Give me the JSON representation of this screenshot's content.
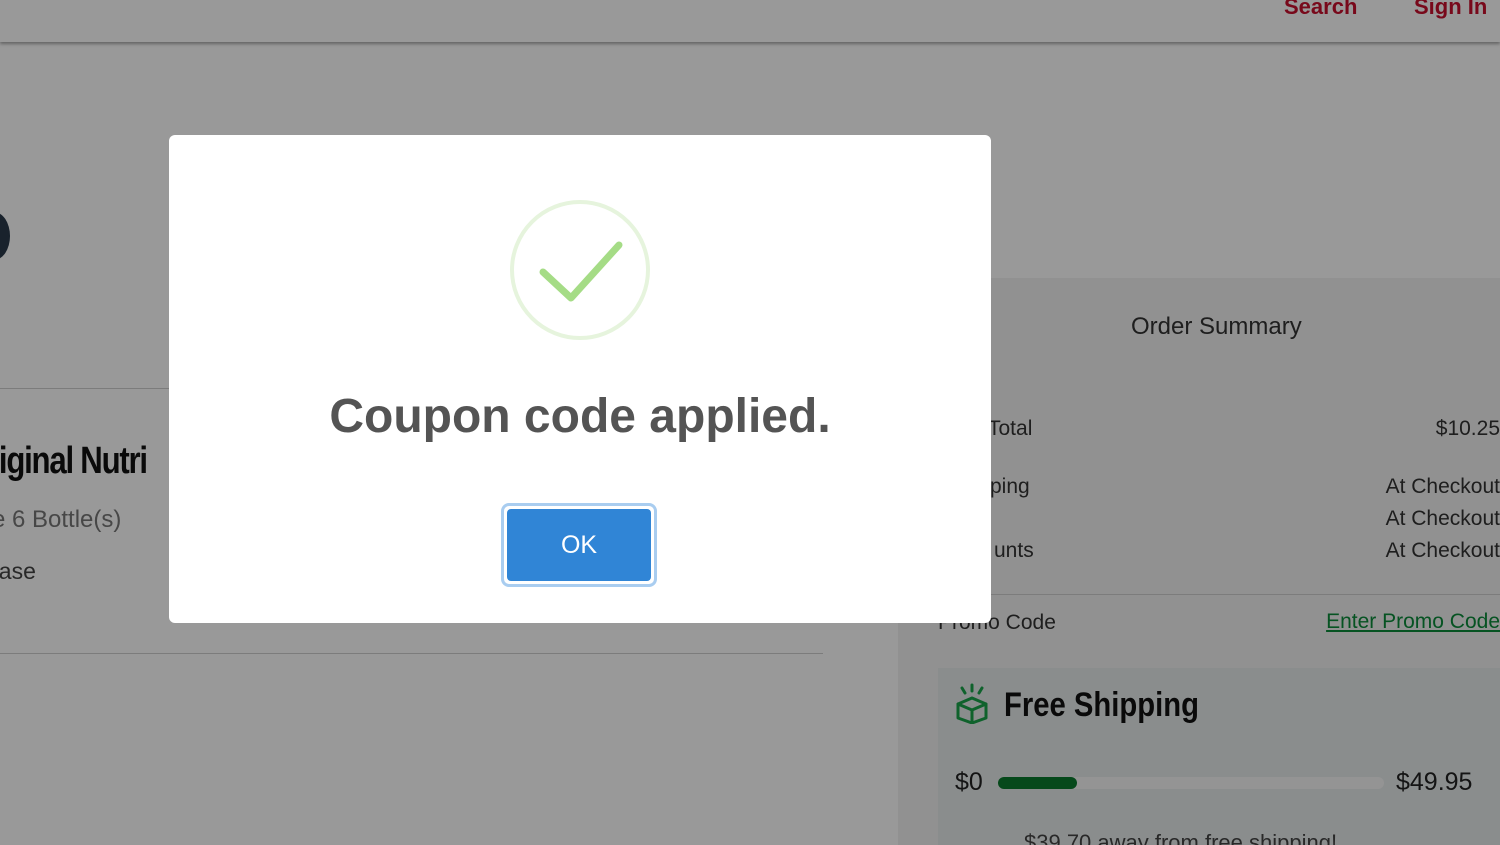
{
  "header": {
    "nav_search": "Search",
    "nav_signin": "Sign In"
  },
  "product": {
    "title": "riginal Nutri",
    "quantity": "e 6 Bottle(s)",
    "purchase": "hase"
  },
  "summary": {
    "title": "Order Summary",
    "rows": [
      {
        "label": "Total",
        "value": "$10.25"
      },
      {
        "label": "ping",
        "value": "At Checkout"
      },
      {
        "label": "",
        "value": "At Checkout"
      },
      {
        "label": "unts",
        "value": "At Checkout"
      }
    ],
    "promo_label": "Promo Code",
    "promo_link": "Enter Promo Code"
  },
  "shipping": {
    "title": "Free Shipping",
    "min_label": "$0",
    "max_label": "$49.95",
    "progress_fraction": 0.205,
    "message": "$39.70 away from free shipping!"
  },
  "modal": {
    "title": "Coupon code applied.",
    "ok_label": "OK",
    "icon": "check-circle-icon"
  },
  "colors": {
    "brand_red": "#c8102e",
    "confirm_blue": "#3085d6",
    "success_green": "#a5dc86",
    "progress_green": "#0a7a2e",
    "link_green": "#0a8a3a"
  }
}
